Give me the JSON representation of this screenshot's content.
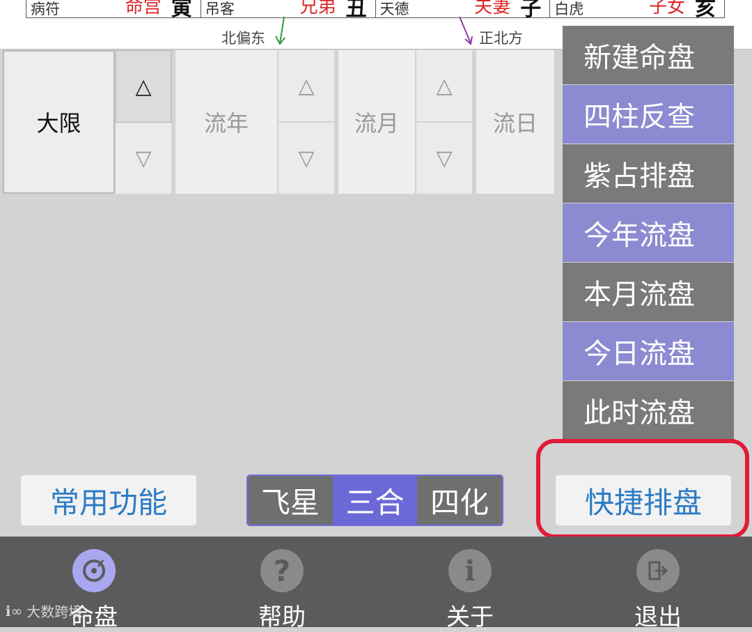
{
  "chart": {
    "palaces": [
      {
        "star": "病符",
        "name": "命宫",
        "branch": "寅"
      },
      {
        "star": "吊客",
        "name": "兄弟",
        "branch": "丑"
      },
      {
        "star": "天德",
        "name": "夫妻",
        "branch": "子"
      },
      {
        "star": "白虎",
        "name": "子女",
        "branch": "亥"
      }
    ],
    "direction_left": "北偏东",
    "direction_right": "正北方"
  },
  "controls": {
    "daxian": "大限",
    "liunian": "流年",
    "liuyue": "流月",
    "liuri": "流日",
    "up": "△",
    "down": "▽"
  },
  "menu": {
    "items": [
      {
        "label": "新建命盘"
      },
      {
        "label": "四柱反查"
      },
      {
        "label": "紫占排盘"
      },
      {
        "label": "今年流盘"
      },
      {
        "label": "本月流盘"
      },
      {
        "label": "今日流盘"
      },
      {
        "label": "此时流盘"
      }
    ]
  },
  "actions": {
    "common": "常用功能",
    "quick": "快捷排盘",
    "segments": [
      "飞星",
      "三合",
      "四化"
    ],
    "selected_segment": "三合"
  },
  "tabbar": {
    "tabs": [
      {
        "label": "命盘",
        "icon": "disc-icon"
      },
      {
        "label": "帮助",
        "icon": "question-icon"
      },
      {
        "label": "关于",
        "icon": "info-icon"
      },
      {
        "label": "退出",
        "icon": "exit-icon"
      }
    ]
  },
  "watermark": "大数跨境",
  "colors": {
    "accent": "#6b69d6",
    "menu_purple": "#8c8ad0",
    "menu_gray": "#7a7a7a",
    "link_blue": "#2c7cc6",
    "highlight_red": "#e01b3a",
    "palace_red": "#d92626"
  }
}
